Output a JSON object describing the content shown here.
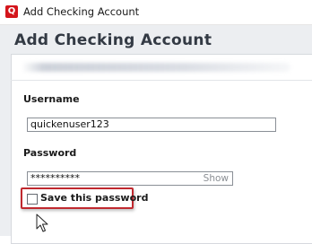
{
  "window": {
    "app_icon_letter": "Q",
    "title": "Add Checking Account"
  },
  "page": {
    "heading": "Add Checking Account"
  },
  "form": {
    "username_label": "Username",
    "username_value": "quickenuser123",
    "password_label": "Password",
    "password_value": "**********",
    "show_label": "Show",
    "save_password_label": "Save this password",
    "save_password_checked": false
  },
  "colors": {
    "brand": "#d4151b",
    "highlight": "#c0292f"
  },
  "icons": {
    "app": "quicken-logo-icon",
    "cursor": "mouse-pointer-icon"
  }
}
